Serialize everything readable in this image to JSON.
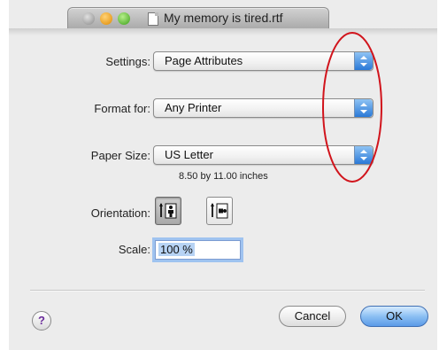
{
  "window": {
    "title": "My memory is tired.rtf"
  },
  "settings": {
    "label": "Settings:",
    "value": "Page Attributes"
  },
  "format_for": {
    "label": "Format for:",
    "value": "Any Printer"
  },
  "paper_size": {
    "label": "Paper Size:",
    "value": "US Letter",
    "description": "8.50 by 11.00 inches"
  },
  "orientation": {
    "label": "Orientation:",
    "selected": "portrait"
  },
  "scale": {
    "label": "Scale:",
    "value": "100 %"
  },
  "help": {
    "glyph": "?"
  },
  "buttons": {
    "cancel": "Cancel",
    "ok": "OK"
  },
  "colors": {
    "annotation": "#d1141c",
    "accent": "#5b9ae8"
  }
}
